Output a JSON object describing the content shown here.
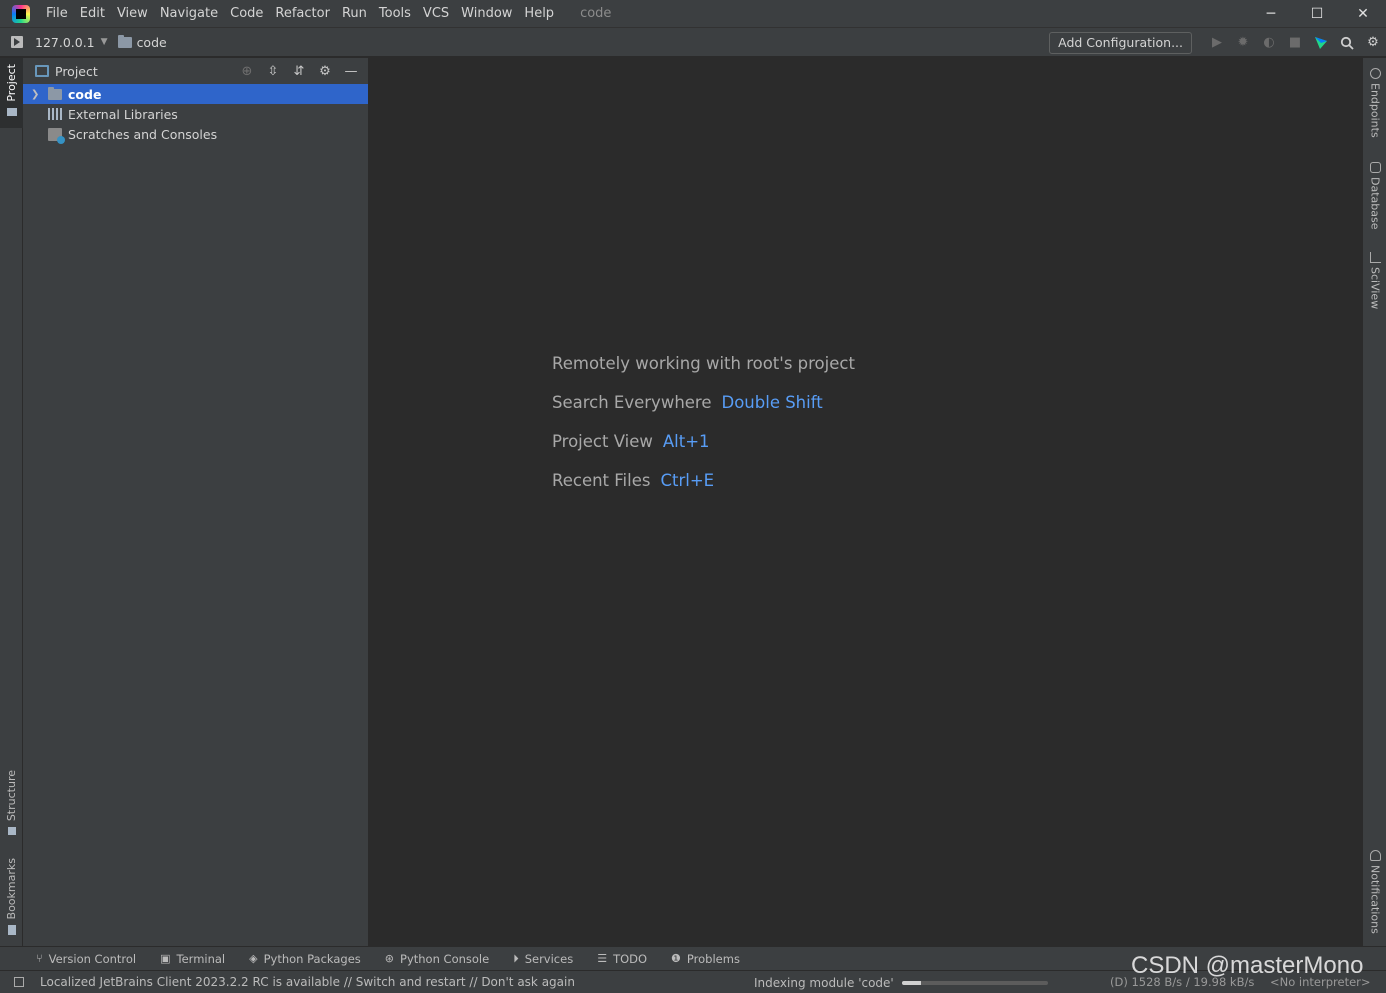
{
  "titlebar": {
    "menu": [
      "File",
      "Edit",
      "View",
      "Navigate",
      "Code",
      "Refactor",
      "Run",
      "Tools",
      "VCS",
      "Window",
      "Help"
    ],
    "title": "code",
    "minimize": "─",
    "maximize": "☐",
    "close": "✕"
  },
  "toolbar": {
    "host": "127.0.0.1",
    "project": "code",
    "add_config": "Add Configuration..."
  },
  "left_tabs": {
    "project": "Project",
    "structure": "Structure",
    "bookmarks": "Bookmarks"
  },
  "project_panel": {
    "title": "Project",
    "tree": [
      "code",
      "External Libraries",
      "Scratches and Consoles"
    ]
  },
  "welcome": {
    "line1": "Remotely working with root's project",
    "search_label": "Search Everywhere",
    "search_key": "Double Shift",
    "project_label": "Project View",
    "project_key": "Alt+1",
    "recent_label": "Recent Files",
    "recent_key": "Ctrl+E"
  },
  "right_tabs": {
    "endpoints": "Endpoints",
    "database": "Database",
    "sciview": "SciView",
    "notifications": "Notifications"
  },
  "bottom_tabs": [
    "Version Control",
    "Terminal",
    "Python Packages",
    "Python Console",
    "Services",
    "TODO",
    "Problems"
  ],
  "status": {
    "message": "Localized JetBrains Client 2023.2.2 RC is available // Switch and restart // Don't ask again",
    "indexing": "Indexing module 'code'",
    "progress": 0.13,
    "network": "(D) 1528 B/s / 19.98 kB/s",
    "interpreter": "<No interpreter>"
  },
  "watermark": "CSDN @masterMono",
  "colors": {
    "accent_key": "#589df6",
    "selection": "#2f65ca",
    "background": "#2b2b2b",
    "panel": "#3c3f41"
  }
}
